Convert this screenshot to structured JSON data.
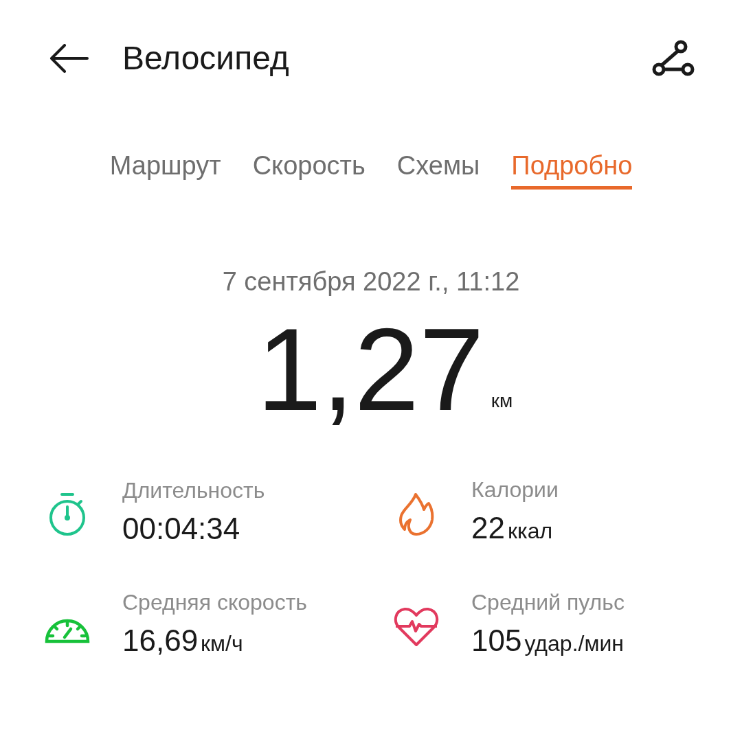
{
  "header": {
    "title": "Велосипед"
  },
  "tabs": [
    {
      "label": "Маршрут",
      "selected": false
    },
    {
      "label": "Скорость",
      "selected": false
    },
    {
      "label": "Схемы",
      "selected": false
    },
    {
      "label": "Подробно",
      "selected": true
    }
  ],
  "date": "7 сентября 2022 г., 11:12",
  "distance": {
    "value": "1,27",
    "unit": "км"
  },
  "stats": [
    {
      "kind": "stopwatch",
      "label": "Длительность",
      "value": "00:04:34"
    },
    {
      "kind": "flame",
      "label": "Калории",
      "value": "22",
      "unit": "ккал"
    },
    {
      "kind": "speedometer",
      "label": "Средняя скорость",
      "value": "16,69",
      "unit": "км/ч"
    },
    {
      "kind": "heart",
      "label": "Средний пульс",
      "value": "105",
      "unit": "удар./мин"
    }
  ]
}
